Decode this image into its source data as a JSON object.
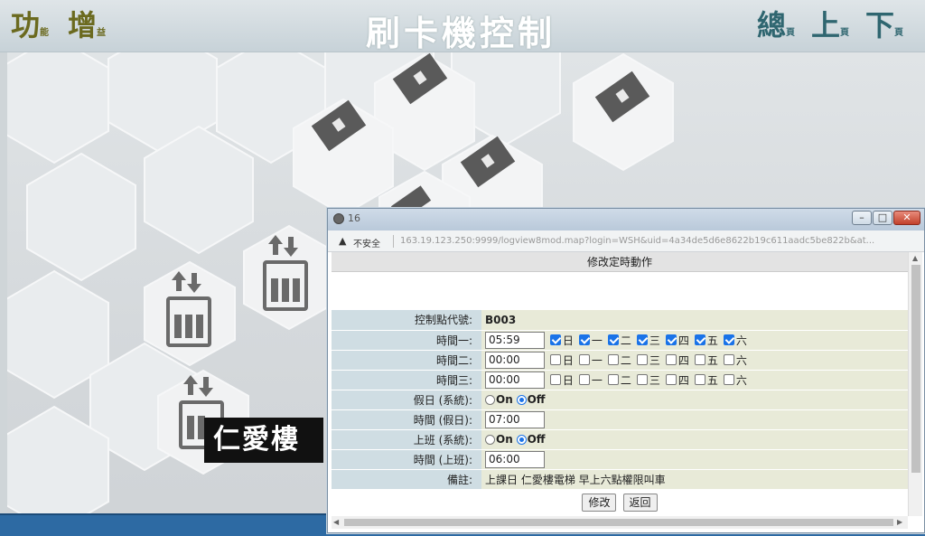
{
  "header": {
    "title": "刷卡機控制",
    "left_buttons": [
      {
        "big": "功",
        "small": "能"
      },
      {
        "big": "增",
        "small": "益"
      }
    ],
    "right_buttons": [
      {
        "big": "總",
        "small": "頁"
      },
      {
        "big": "上",
        "small": "頁"
      },
      {
        "big": "下",
        "small": "頁"
      }
    ]
  },
  "building_label": "仁愛樓",
  "colors": {
    "left_button_text": "#6b6a1f",
    "right_button_text": "#2f6670",
    "bottom_bar": "#2d6aa3"
  },
  "popup": {
    "window_title": "16",
    "security_warning": "不安全",
    "url": "163.19.123.250:9999/logview8mod.map?login=WSH&uid=4a34de5d6e8622b19c611aadc5be822b&at...",
    "form_title": "修改定時動作",
    "rows": {
      "control_point_label": "控制點代號:",
      "control_point_value": "B003",
      "time1_label": "時間一:",
      "time1_value": "05:59",
      "time2_label": "時間二:",
      "time2_value": "00:00",
      "time3_label": "時間三:",
      "time3_value": "00:00",
      "holiday_label": "假日 (系統):",
      "holiday_time_label": "時間 (假日):",
      "holiday_time_value": "07:00",
      "work_label": "上班 (系統):",
      "work_time_label": "時間 (上班):",
      "work_time_value": "06:00",
      "note_label": "備註:",
      "note_value": "上課日 仁愛樓電梯 早上六點權限叫車"
    },
    "days": [
      "日",
      "一",
      "二",
      "三",
      "四",
      "五",
      "六"
    ],
    "time1_days_checked": [
      true,
      true,
      true,
      true,
      true,
      true,
      true
    ],
    "time2_days_checked": [
      false,
      false,
      false,
      false,
      false,
      false,
      false
    ],
    "time3_days_checked": [
      false,
      false,
      false,
      false,
      false,
      false,
      false
    ],
    "on_label": "On",
    "off_label": "Off",
    "holiday_selected": "Off",
    "work_selected": "Off",
    "modify_button": "修改",
    "back_button": "返回"
  }
}
